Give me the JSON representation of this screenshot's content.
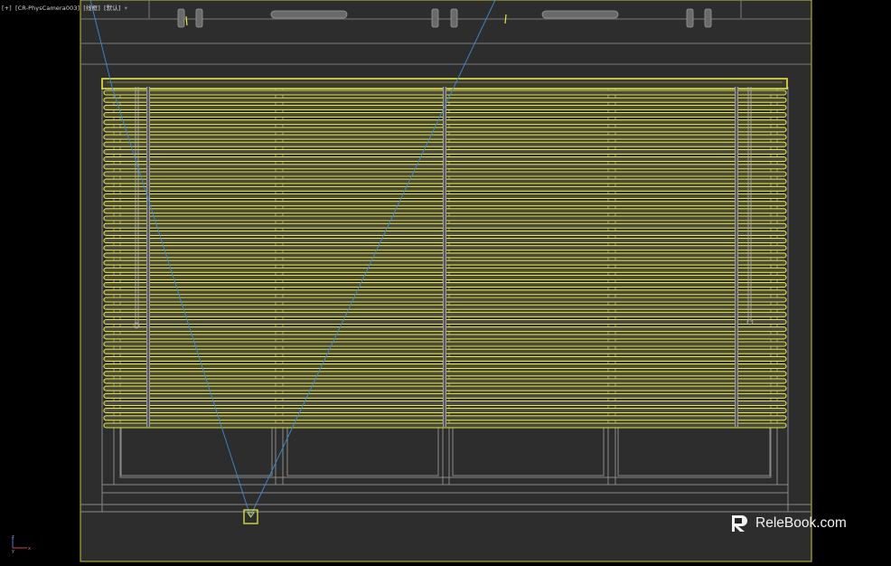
{
  "viewport": {
    "label_plus": "[+]",
    "camera_name": "[CR-PhysCamera003]",
    "shading_mode": "[线框]",
    "view_mode": "[默认]",
    "menu_arrow": "▾"
  },
  "watermark": {
    "text": "ReleBook.com",
    "icon": "relebook-logo"
  },
  "axis_gizmo": {
    "z": "z",
    "x": "x",
    "y": "y"
  },
  "colors": {
    "viewport_bg": "#2d2d2d",
    "letterbox": "#000000",
    "safe_frame": "#c8c832",
    "selection_yellow": "#e6e646",
    "frustum_blue": "#3c8cd2",
    "wire_grey": "#8a8a8a",
    "slat_fill": "#4a4a3a"
  }
}
